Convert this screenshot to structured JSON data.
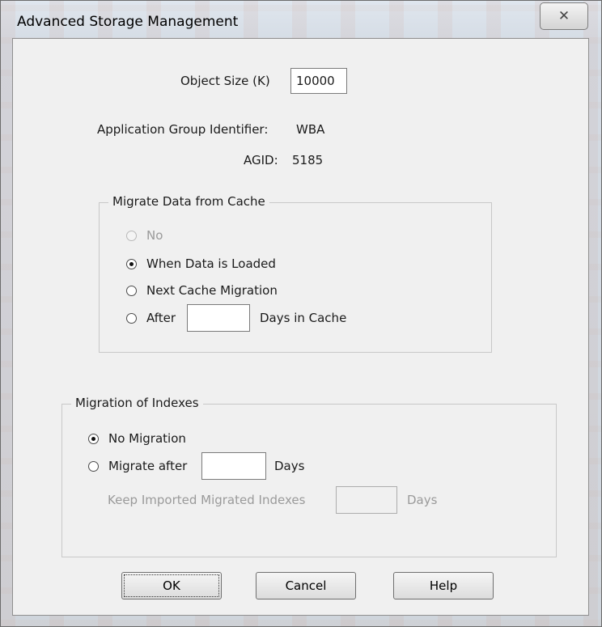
{
  "window": {
    "title": "Advanced Storage Management",
    "close_glyph": "✕"
  },
  "object_size": {
    "label": "Object Size (K)",
    "value": "10000"
  },
  "app_group": {
    "label": "Application Group Identifier:",
    "value": "WBA"
  },
  "agid": {
    "label": "AGID:",
    "value": "5185"
  },
  "migrate_data": {
    "title": "Migrate Data from Cache",
    "options": [
      {
        "label": "No",
        "selected": false,
        "enabled": false
      },
      {
        "label": "When Data is Loaded",
        "selected": true,
        "enabled": true
      },
      {
        "label": "Next Cache Migration",
        "selected": false,
        "enabled": true
      },
      {
        "label": "After",
        "selected": false,
        "enabled": true
      }
    ],
    "after_days_value": "",
    "after_days_suffix": "Days in Cache"
  },
  "migration_indexes": {
    "title": "Migration of Indexes",
    "options": [
      {
        "label": "No Migration",
        "selected": true,
        "enabled": true
      },
      {
        "label": "Migrate after",
        "selected": false,
        "enabled": true
      }
    ],
    "migrate_days_value": "",
    "migrate_days_suffix": "Days",
    "keep_label": "Keep Imported Migrated Indexes",
    "keep_days_value": "",
    "keep_days_suffix": "Days"
  },
  "buttons": {
    "ok": "OK",
    "cancel": "Cancel",
    "help": "Help"
  },
  "colors": {
    "client_bg": "#f0f0f0",
    "disabled_text": "#9a9a9a"
  }
}
